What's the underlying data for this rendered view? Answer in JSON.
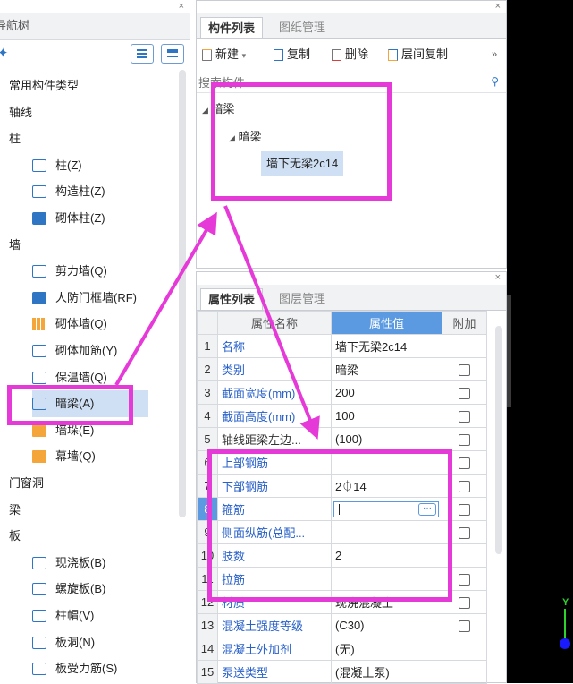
{
  "nav": {
    "title": "导航树",
    "items": [
      {
        "label": "常用构件类型",
        "level": 0
      },
      {
        "label": "轴线",
        "level": 0
      },
      {
        "label": "柱",
        "level": 0
      },
      {
        "label": "柱(Z)",
        "level": 1,
        "icon": "column-icon"
      },
      {
        "label": "构造柱(Z)",
        "level": 1,
        "icon": "construction-column-icon"
      },
      {
        "label": "砌体柱(Z)",
        "level": 1,
        "icon": "masonry-column-icon"
      },
      {
        "label": "墙",
        "level": 0
      },
      {
        "label": "剪力墙(Q)",
        "level": 1,
        "icon": "shear-wall-icon"
      },
      {
        "label": "人防门框墙(RF)",
        "level": 1,
        "icon": "civil-defense-door-wall-icon"
      },
      {
        "label": "砌体墙(Q)",
        "level": 1,
        "icon": "masonry-wall-icon"
      },
      {
        "label": "砌体加筋(Y)",
        "level": 1,
        "icon": "masonry-reinforcement-icon"
      },
      {
        "label": "保温墙(Q)",
        "level": 1,
        "icon": "insulation-wall-icon"
      },
      {
        "label": "暗梁(A)",
        "level": 1,
        "icon": "hidden-beam-icon",
        "selected": true
      },
      {
        "label": "墙垛(E)",
        "level": 1,
        "icon": "wall-pier-icon"
      },
      {
        "label": "幕墙(Q)",
        "level": 1,
        "icon": "curtain-wall-icon"
      },
      {
        "label": "门窗洞",
        "level": 0
      },
      {
        "label": "梁",
        "level": 0
      },
      {
        "label": "板",
        "level": 0
      },
      {
        "label": "现浇板(B)",
        "level": 1,
        "icon": "cast-slab-icon"
      },
      {
        "label": "螺旋板(B)",
        "level": 1,
        "icon": "spiral-slab-icon"
      },
      {
        "label": "柱帽(V)",
        "level": 1,
        "icon": "column-cap-icon"
      },
      {
        "label": "板洞(N)",
        "level": 1,
        "icon": "slab-hole-icon"
      },
      {
        "label": "板受力筋(S)",
        "level": 1,
        "icon": "slab-rebar-icon"
      }
    ]
  },
  "component": {
    "tabs": [
      "构件列表",
      "图纸管理"
    ],
    "toolbar": {
      "new": "新建",
      "copy": "复制",
      "delete": "删除",
      "floor_copy": "层间复制",
      "more": "»"
    },
    "search_placeholder": "搜索构件...",
    "tree": {
      "root": "暗梁",
      "child": "暗梁",
      "leaf": "墙下无梁2c14"
    }
  },
  "props": {
    "tabs": [
      "属性列表",
      "图层管理"
    ],
    "headers": {
      "name": "属性名称",
      "value": "属性值",
      "extra": "附加"
    },
    "rows": [
      {
        "n": "1",
        "name": "名称",
        "value": "墙下无梁2c14",
        "chk": false,
        "blue": true
      },
      {
        "n": "2",
        "name": "类别",
        "value": "暗梁",
        "chk": true,
        "blue": true
      },
      {
        "n": "3",
        "name": "截面宽度(mm)",
        "value": "200",
        "chk": true,
        "blue": true
      },
      {
        "n": "4",
        "name": "截面高度(mm)",
        "value": "100",
        "chk": true,
        "blue": true
      },
      {
        "n": "5",
        "name": "轴线距梁左边...",
        "value": "(100)",
        "chk": true,
        "blue": false
      },
      {
        "n": "6",
        "name": "上部钢筋",
        "value": "",
        "chk": true,
        "blue": true
      },
      {
        "n": "7",
        "name": "下部钢筋",
        "value": "2⏀14",
        "chk": true,
        "blue": true
      },
      {
        "n": "8",
        "name": "箍筋",
        "value": "",
        "chk": true,
        "blue": true,
        "editing": true
      },
      {
        "n": "9",
        "name": "侧面纵筋(总配...",
        "value": "",
        "chk": true,
        "blue": true
      },
      {
        "n": "10",
        "name": "肢数",
        "value": "2",
        "chk": false,
        "blue": true
      },
      {
        "n": "11",
        "name": "拉筋",
        "value": "",
        "chk": true,
        "blue": true
      },
      {
        "n": "12",
        "name": "材质",
        "value": "现浇混凝土",
        "chk": true,
        "blue": true
      },
      {
        "n": "13",
        "name": "混凝土强度等级",
        "value": "(C30)",
        "chk": true,
        "blue": true
      },
      {
        "n": "14",
        "name": "混凝土外加剂",
        "value": "(无)",
        "chk": false,
        "blue": true
      },
      {
        "n": "15",
        "name": "泵送类型",
        "value": "(混凝土泵)",
        "chk": false,
        "blue": true
      }
    ]
  },
  "viewport": {
    "axis_label": "Y",
    "axis_color": "#2fd12f"
  },
  "colors": {
    "annotation": "#e53ad8",
    "accent": "#2e75c4",
    "header_blue": "#5b9ae0"
  }
}
